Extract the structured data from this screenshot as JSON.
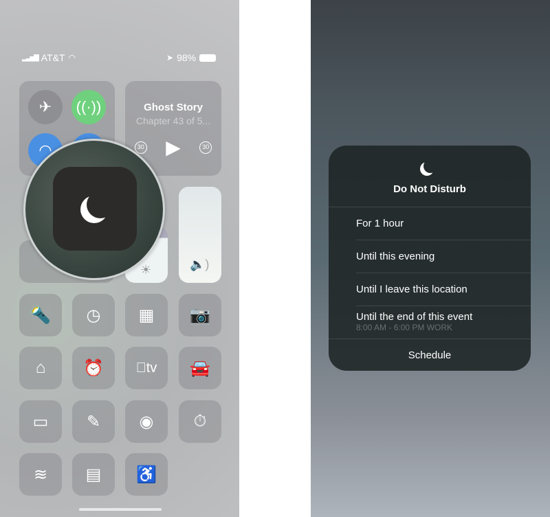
{
  "status_bar": {
    "carrier": "AT&T",
    "battery": "98%"
  },
  "control_center": {
    "connectivity": [
      "airplane-mode",
      "cellular-data",
      "wifi",
      "bluetooth"
    ],
    "media": {
      "title": "Ghost Story",
      "subtitle": "Chapter 43 of 5...",
      "skip_back": "30",
      "skip_forward": "30"
    },
    "magnified": "do-not-disturb",
    "buttons": [
      "flashlight",
      "timer",
      "calculator",
      "camera",
      "home",
      "alarm",
      "apple-tv",
      "carplay",
      "low-power",
      "notes",
      "screen-record",
      "stopwatch",
      "voice-memos",
      "wallet",
      "accessibility"
    ],
    "apple_tv_label": "tv"
  },
  "dnd_menu": {
    "title": "Do Not Disturb",
    "options": [
      {
        "label": "For 1 hour"
      },
      {
        "label": "Until this evening"
      },
      {
        "label": "Until I leave this location"
      },
      {
        "label": "Until the end of this event",
        "detail": "8:00 AM - 6:00 PM WORK"
      }
    ],
    "schedule": "Schedule"
  },
  "colors": {
    "cellular_active": "#6fd17e",
    "wifi_active": "#4a90e2"
  }
}
